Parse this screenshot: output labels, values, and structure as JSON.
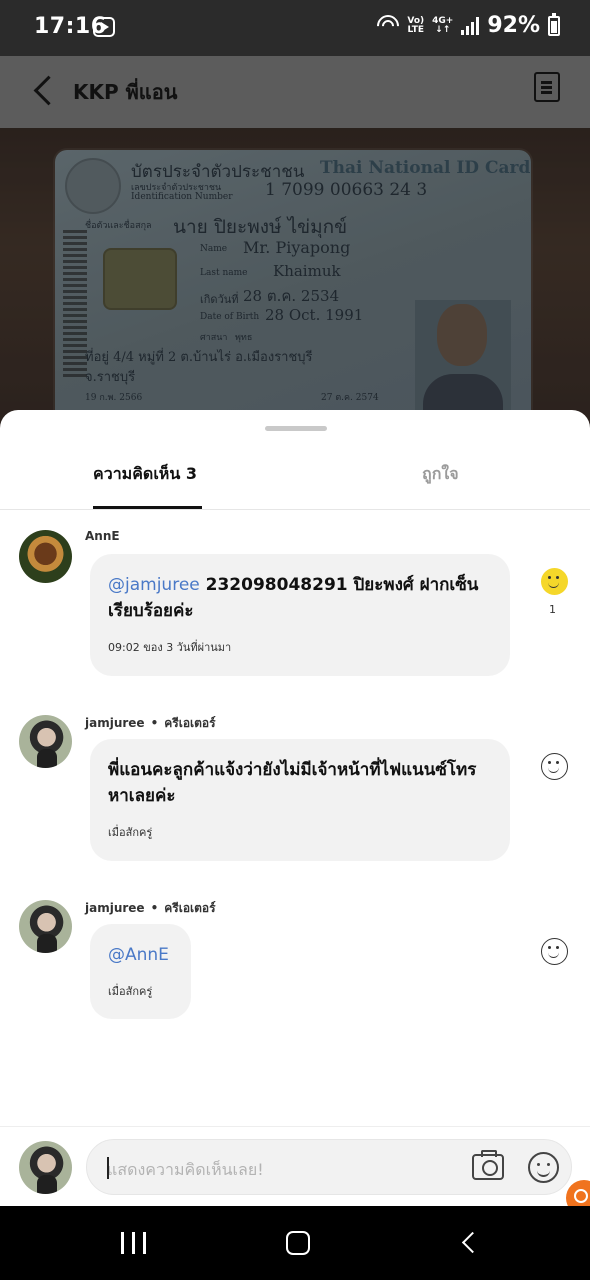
{
  "status_bar": {
    "time": "17:16",
    "volte_top": "Vo)",
    "volte_bottom": "LTE",
    "network_top": "4G+",
    "network_bottom": "↓↑",
    "battery": "92%"
  },
  "header": {
    "title": "KKP พี่แอน"
  },
  "id_card": {
    "heading_th": "บัตรประจำตัวประชาชน",
    "heading_en": "Thai National ID Card",
    "id_label_th": "เลขประจำตัวประชาชน",
    "id_label_en": "Identification Number",
    "id_number": "1 7099 00663 24 3",
    "name_label_th": "ชื่อตัวและชื่อสกุล",
    "name_th": "นาย ปิยะพงษ์ ไข่มุกข์",
    "name_label_en": "Name",
    "name_en": "Mr. Piyapong",
    "lastname_label_en": "Last name",
    "lastname_en": "Khaimuk",
    "dob_label_th": "เกิดวันที่",
    "dob_th": "28 ต.ค. 2534",
    "dob_label_en": "Date of Birth",
    "dob_en": "28 Oct. 1991",
    "religion_label": "ศาสนา",
    "religion": "พุทธ",
    "address_1": "ที่อยู่ 4/4 หมู่ที่ 2 ต.บ้านไร่ อ.เมืองราชบุรี",
    "address_2": "จ.ราชบุรี",
    "issue_date": "19 ก.พ. 2566",
    "expiry_date": "27 ต.ค. 2574"
  },
  "tabs": {
    "comments": "ความคิดเห็น 3",
    "likes": "ถูกใจ"
  },
  "comments": [
    {
      "username": "AnnE",
      "mention": "@jamjuree",
      "text": " 232098048291 ปิยะพงศ์ ฝากเซ็นเรียบร้อยค่ะ",
      "time": "09:02 ของ 3 วันที่ผ่านมา",
      "like_count": "1",
      "liked": true
    },
    {
      "username": "jamjuree",
      "badge": "ครีเอเตอร์",
      "separator": "•",
      "text": "พี่แอนคะลูกค้าแจ้งว่ายังไม่มีเจ้าหน้าที่ไฟแนนซ์โทรหาเลยค่ะ",
      "time": "เมื่อสักครู่"
    },
    {
      "username": "jamjuree",
      "badge": "ครีเอเตอร์",
      "separator": "•",
      "mention": "@AnnE",
      "time": "เมื่อสักครู่"
    }
  ],
  "input": {
    "placeholder": "แสดงความคิดเห็นเลย!"
  },
  "icons": {
    "back": "back-arrow-icon",
    "menu": "document-icon",
    "camera": "camera-icon",
    "emoji": "emoji-icon",
    "like": "smile-icon"
  },
  "colors": {
    "mention": "#4a79c7",
    "liked": "#f5d72a",
    "fab": "#f0731e"
  }
}
